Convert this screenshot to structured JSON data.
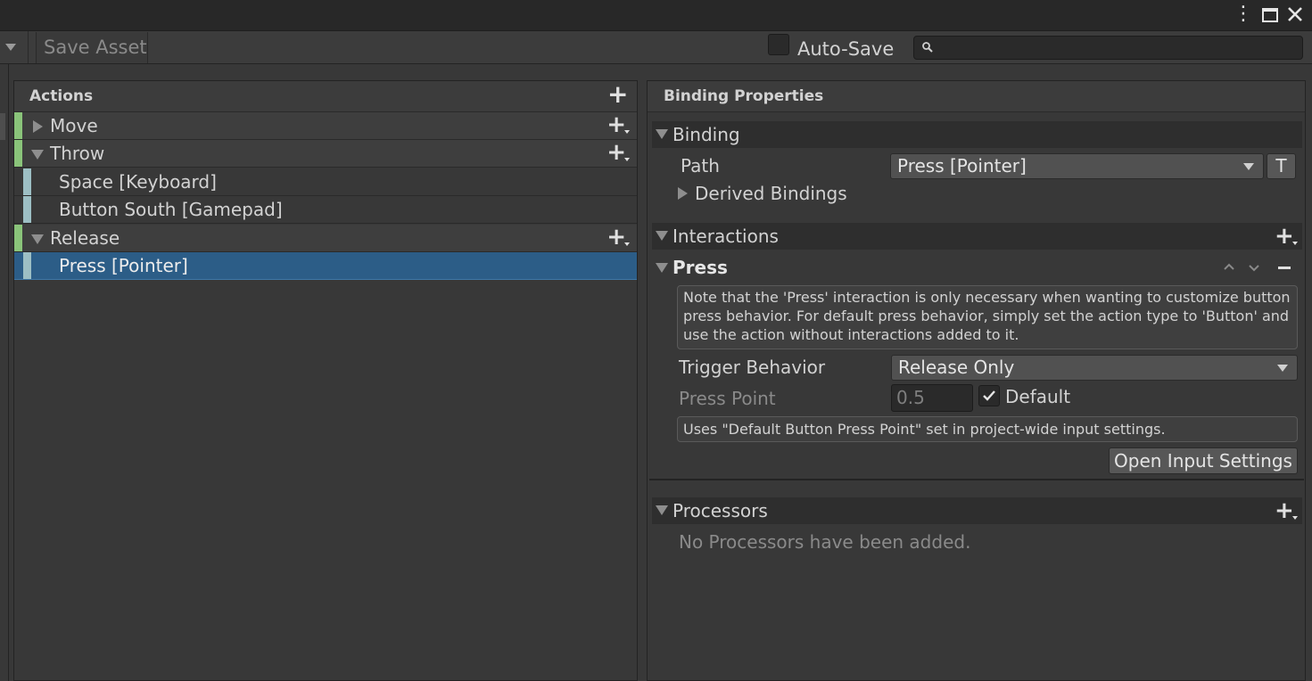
{
  "window": {
    "menu_icon": "vertical-ellipsis-icon",
    "maximize_icon": "maximize-icon",
    "close_icon": "close-icon"
  },
  "toolbar": {
    "save_asset_label": "Save Asset",
    "auto_save_label": "Auto-Save",
    "auto_save_checked": false,
    "search_placeholder": "",
    "search_value": ""
  },
  "actions_panel": {
    "title": "Actions",
    "items": [
      {
        "type": "action",
        "label": "Move",
        "expanded": false
      },
      {
        "type": "action",
        "label": "Throw",
        "expanded": true
      },
      {
        "type": "binding",
        "label": "Space [Keyboard]"
      },
      {
        "type": "binding",
        "label": "Button South [Gamepad]"
      },
      {
        "type": "action",
        "label": "Release",
        "expanded": true
      },
      {
        "type": "binding",
        "label": "Press [Pointer]",
        "selected": true
      }
    ]
  },
  "properties_panel": {
    "title": "Binding Properties",
    "binding": {
      "section_label": "Binding",
      "path_label": "Path",
      "path_value": "Press [Pointer]",
      "t_button_label": "T",
      "derived_label": "Derived Bindings"
    },
    "interactions": {
      "section_label": "Interactions",
      "press": {
        "label": "Press",
        "note": "Note that the 'Press' interaction is only necessary when wanting to customize button press behavior. For default press behavior, simply set the action type to 'Button' and use the action without interactions added to it.",
        "trigger_label": "Trigger Behavior",
        "trigger_value": "Release Only",
        "press_point_label": "Press Point",
        "press_point_value": "0.5",
        "default_label": "Default",
        "default_checked": true,
        "settings_note": "Uses \"Default Button Press Point\" set in project-wide input settings.",
        "open_settings_label": "Open Input Settings"
      }
    },
    "processors": {
      "section_label": "Processors",
      "empty_text": "No Processors have been added."
    }
  },
  "colors": {
    "action_stripe": "#8ac47a",
    "binding_stripe": "#9dbfc4",
    "selection": "#2c5d87"
  }
}
